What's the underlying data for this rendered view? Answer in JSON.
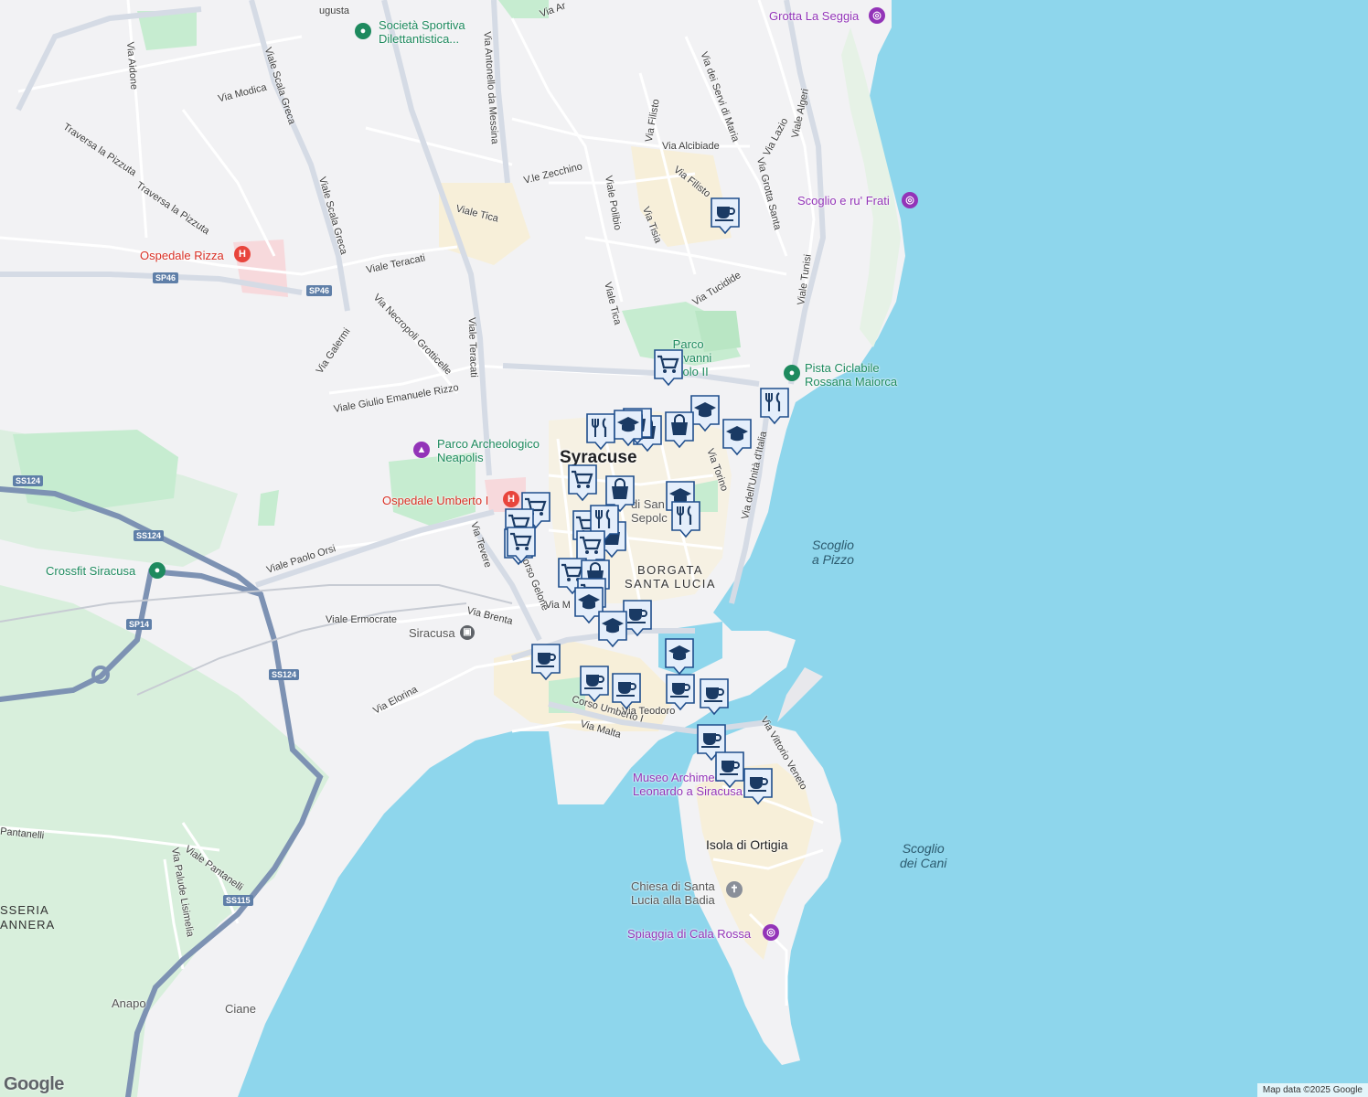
{
  "map": {
    "colors": {
      "land": "#f2f2f4",
      "water": "#8ed6ec",
      "park": "#c6ecd0",
      "urban": "#f7efd9",
      "highway": "#7d92b3",
      "road": "#ffffff",
      "marker_bg": "#e4eefb",
      "marker_border": "#1f4e8c",
      "marker_icon": "#1a3a64"
    },
    "labels": {
      "city": "Syracuse",
      "districts": {
        "santa_lucia": "BORGATA\nSANTA LUCIA"
      },
      "island": "Isola di Ortigia",
      "water": {
        "scoglio_pizzo": "Scoglio\na Pizzo",
        "scoglio_cani": "Scoglio\ndei Cani"
      },
      "area": {
        "sasseria": "SSERIA\nANNERA"
      },
      "places": {
        "anapo": "Anapo",
        "ciane": "Ciane",
        "san_sepolcro": "di San\nSepolc"
      },
      "streets": [
        "ugusta",
        "Via Ar",
        "Via Antonello da Messina",
        "Via Aidone",
        "Viale Scala Greca",
        "Via Modica",
        "Traversa la Pizzuta",
        "Traversa la Pizzuta",
        "Viale Scala Greca",
        "Viale Tica",
        "V.le Zecchino",
        "Viale Polibio",
        "Via Tisia",
        "Via Filisto",
        "Via Filisto",
        "Via dei Servi di Maria",
        "Via Alcibiade",
        "Via Lazio",
        "Viale Algeri",
        "Via Grotta Santa",
        "Viale Teracati",
        "Via Necropoli Grotticelle",
        "Via Galermi",
        "Viale Teracati",
        "Viale Tica",
        "Via Tucidide",
        "Viale Tunisi",
        "Viale Giulio Emanuele Rizzo",
        "Via Torino",
        "Via dell'Unità d'Italia",
        "Viale Paolo Orsi",
        "Via Tevere",
        "Corso Gelone",
        "Via Brenta",
        "Viale Ermocrate",
        "Via Elorina",
        "Corso Umberto I",
        "Via Malta",
        "Via Vittorio Veneto",
        "Viale Pantanelli",
        "Pantanelli",
        "Via Palude Lisimelia",
        "Via M",
        "Via Teodoro"
      ],
      "shields": [
        "SS124",
        "SS124",
        "SS124",
        "SS115",
        "SP14",
        "SP46",
        "SP46"
      ]
    },
    "pois": {
      "societa": "Società Sportiva\nDilettantistica...",
      "grotta": "Grotta La Seggia",
      "scoglio_frati": "Scoglio e ru' Frati",
      "ospedale_rizza": "Ospedale Rizza",
      "parco_giovanni": "Parco\nGiovanni\nPaolo II",
      "pista": "Pista Ciclabile\nRossana Maiorca",
      "parco_arch": "Parco Archeologico\nNeapolis",
      "ospedale_umberto": "Ospedale Umberto I",
      "crossfit": "Crossfit Siracusa",
      "stazione": "Siracusa",
      "museo": "Museo Archimede e\nLeonardo a Siracusa",
      "chiesa": "Chiesa di Santa\nLucia alla Badia",
      "spiaggia": "Spiaggia di Cala Rossa"
    },
    "markers": [
      {
        "icon": "cup"
      },
      {
        "icon": "cart"
      },
      {
        "icon": "fork"
      },
      {
        "icon": "grad"
      },
      {
        "icon": "grad"
      },
      {
        "icon": "bag"
      },
      {
        "icon": "bag"
      },
      {
        "icon": "fork"
      },
      {
        "icon": "bag"
      },
      {
        "icon": "grad"
      },
      {
        "icon": "cart"
      },
      {
        "icon": "cart"
      },
      {
        "icon": "bag"
      },
      {
        "icon": "grad"
      },
      {
        "icon": "fork"
      },
      {
        "icon": "cart"
      },
      {
        "icon": "cart"
      },
      {
        "icon": "cup"
      },
      {
        "icon": "cart"
      },
      {
        "icon": "bag"
      },
      {
        "icon": "fork"
      },
      {
        "icon": "cart"
      },
      {
        "icon": "cart"
      },
      {
        "icon": "bag"
      },
      {
        "icon": "cart"
      },
      {
        "icon": "grad"
      },
      {
        "icon": "cup"
      },
      {
        "icon": "grad"
      },
      {
        "icon": "cup"
      },
      {
        "icon": "cup"
      },
      {
        "icon": "cup"
      },
      {
        "icon": "grad"
      },
      {
        "icon": "cup"
      },
      {
        "icon": "cup"
      },
      {
        "icon": "cup"
      },
      {
        "icon": "cup"
      },
      {
        "icon": "cup"
      }
    ],
    "attribution": "Map data ©2025 Google",
    "logo": "Google"
  }
}
